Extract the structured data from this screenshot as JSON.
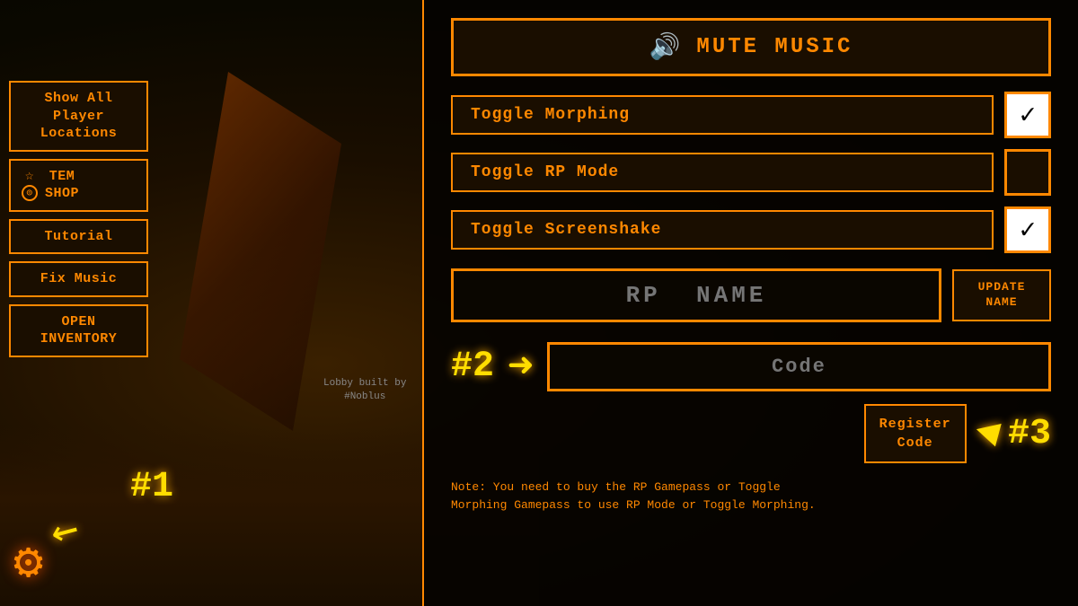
{
  "background": {
    "lobby_credit_line1": "Lobby built by",
    "lobby_credit_line2": "#Noblus"
  },
  "sidebar": {
    "show_all_label": "Show All\nPlayer\nLocations",
    "tem_shop_label": "TEM\nSHOP",
    "tutorial_label": "Tutorial",
    "fix_music_label": "Fix Music",
    "open_inventory_label": "OPEN\nINVENTORY"
  },
  "annotations": {
    "number1": "#1",
    "number2": "#2",
    "number3": "#3"
  },
  "panel": {
    "mute_music_label": "MUTE MUSIC",
    "toggle_morphing_label": "Toggle Morphing",
    "toggle_morphing_checked": true,
    "toggle_rp_mode_label": "Toggle RP Mode",
    "toggle_rp_mode_checked": false,
    "toggle_screenshake_label": "Toggle Screenshake",
    "toggle_screenshake_checked": true,
    "rp_name_placeholder": "RP  NAME",
    "update_name_label": "UPDATE NAME",
    "code_placeholder": "Code",
    "register_code_label": "Register\nCode",
    "note_text": "Note: You need to buy the RP Gamepass or Toggle\nMorphing Gamepass to use RP Mode or Toggle Morphing."
  }
}
